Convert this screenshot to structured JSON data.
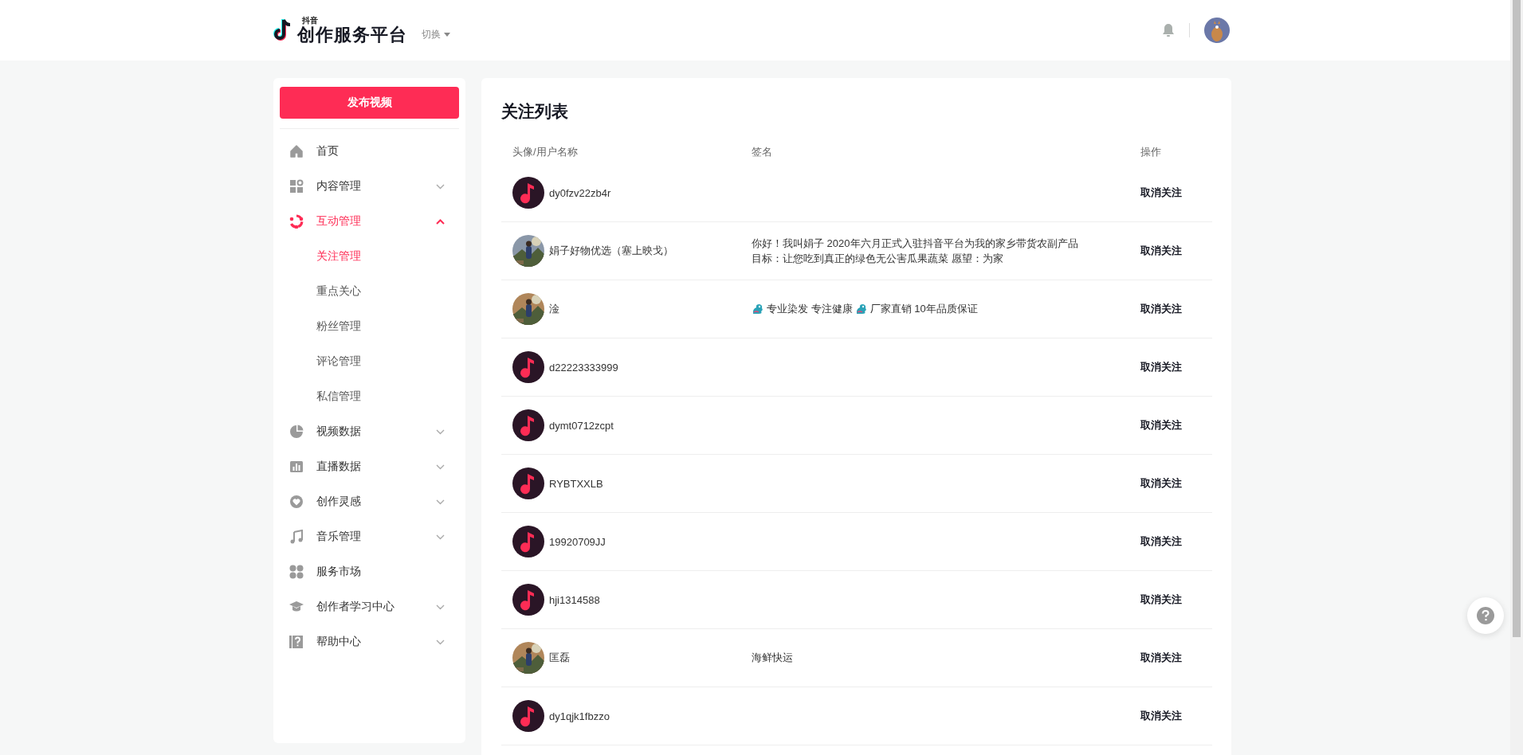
{
  "header": {
    "brand_small": "抖音",
    "brand": "创作服务平台",
    "switch_label": "切换"
  },
  "sidebar": {
    "publish_button": "发布视频",
    "items": [
      {
        "label": "首页"
      },
      {
        "label": "内容管理",
        "expanded": false
      },
      {
        "label": "互动管理",
        "expanded": true,
        "children": [
          {
            "label": "关注管理",
            "selected": true
          },
          {
            "label": "重点关心",
            "selected": false
          },
          {
            "label": "粉丝管理",
            "selected": false
          },
          {
            "label": "评论管理",
            "selected": false
          },
          {
            "label": "私信管理",
            "selected": false
          }
        ]
      },
      {
        "label": "视频数据",
        "expanded": false
      },
      {
        "label": "直播数据",
        "expanded": false
      },
      {
        "label": "创作灵感",
        "expanded": false
      },
      {
        "label": "音乐管理",
        "expanded": false
      },
      {
        "label": "服务市场"
      },
      {
        "label": "创作者学习中心",
        "expanded": false
      },
      {
        "label": "帮助中心",
        "expanded": false
      }
    ]
  },
  "main": {
    "title": "关注列表",
    "columns": [
      "头像/用户名称",
      "签名",
      "操作"
    ],
    "rows": [
      {
        "kind": "default",
        "name": "dy0fzv22zb4r",
        "action": "取消关注"
      },
      {
        "kind": "picture",
        "name": "娟子好物优选（塞上映戈）",
        "signature": [
          {
            "kind": "line",
            "text": "你好！我叫娟子 2020年六月正式入驻抖音平台为我的家乡带货农副产品"
          },
          {
            "kind": "line",
            "text": "目标：让您吃到真正的绿色无公害瓜果蔬菜 愿望：为家"
          }
        ],
        "action": "取消关注"
      },
      {
        "kind": "picture",
        "name": "淦",
        "signature": [
          {
            "kind": "icon"
          },
          {
            "kind": "text",
            "text": "专业染发 专注健康"
          },
          {
            "kind": "icon"
          },
          {
            "kind": "text",
            "text": "厂家直销 10年品质保证"
          }
        ],
        "action": "取消关注"
      },
      {
        "kind": "default",
        "name": "d22223333999",
        "action": "取消关注"
      },
      {
        "kind": "default",
        "name": "dymt0712zcpt",
        "action": "取消关注"
      },
      {
        "kind": "default",
        "name": "RYBTXXLB",
        "action": "取消关注"
      },
      {
        "kind": "default",
        "name": "19920709JJ",
        "action": "取消关注"
      },
      {
        "kind": "default",
        "name": "hji1314588",
        "action": "取消关注"
      },
      {
        "kind": "picture",
        "name": "匡磊",
        "signature": [
          {
            "kind": "text",
            "text": "海鲜快运"
          }
        ],
        "action": "取消关注"
      },
      {
        "kind": "default",
        "name": "dy1qjk1fbzzo",
        "action": "取消关注"
      }
    ]
  }
}
